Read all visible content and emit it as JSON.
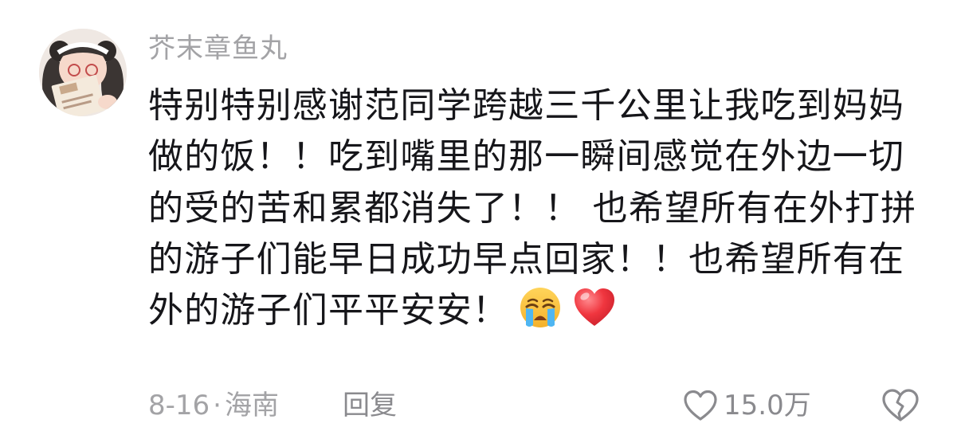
{
  "comment": {
    "username": "芥末章鱼丸",
    "text_lines": [
      "特别特别感谢范同学跨越三千公里让我吃到妈妈",
      "做的饭！！吃到嘴里的那一瞬间感觉在外边一切",
      "的受的苦和累都消失了！！ 也希望所有在外打拼",
      "的游子们能早日成功早点回家！！也希望所有在",
      "外的游子们平平安安！"
    ],
    "emojis": [
      "crying-face-emoji",
      "red-heart-emoji"
    ],
    "date": "8-16",
    "separator": "·",
    "location": "海南",
    "reply_label": "回复",
    "like_count": "15.0万",
    "icons": {
      "like": "heart-outline-icon",
      "dislike": "broken-heart-icon"
    }
  },
  "colors": {
    "text": "#16161a",
    "secondary": "#a3a3a6",
    "action": "#8a8a8e",
    "heart_emoji": "#e8303a"
  }
}
